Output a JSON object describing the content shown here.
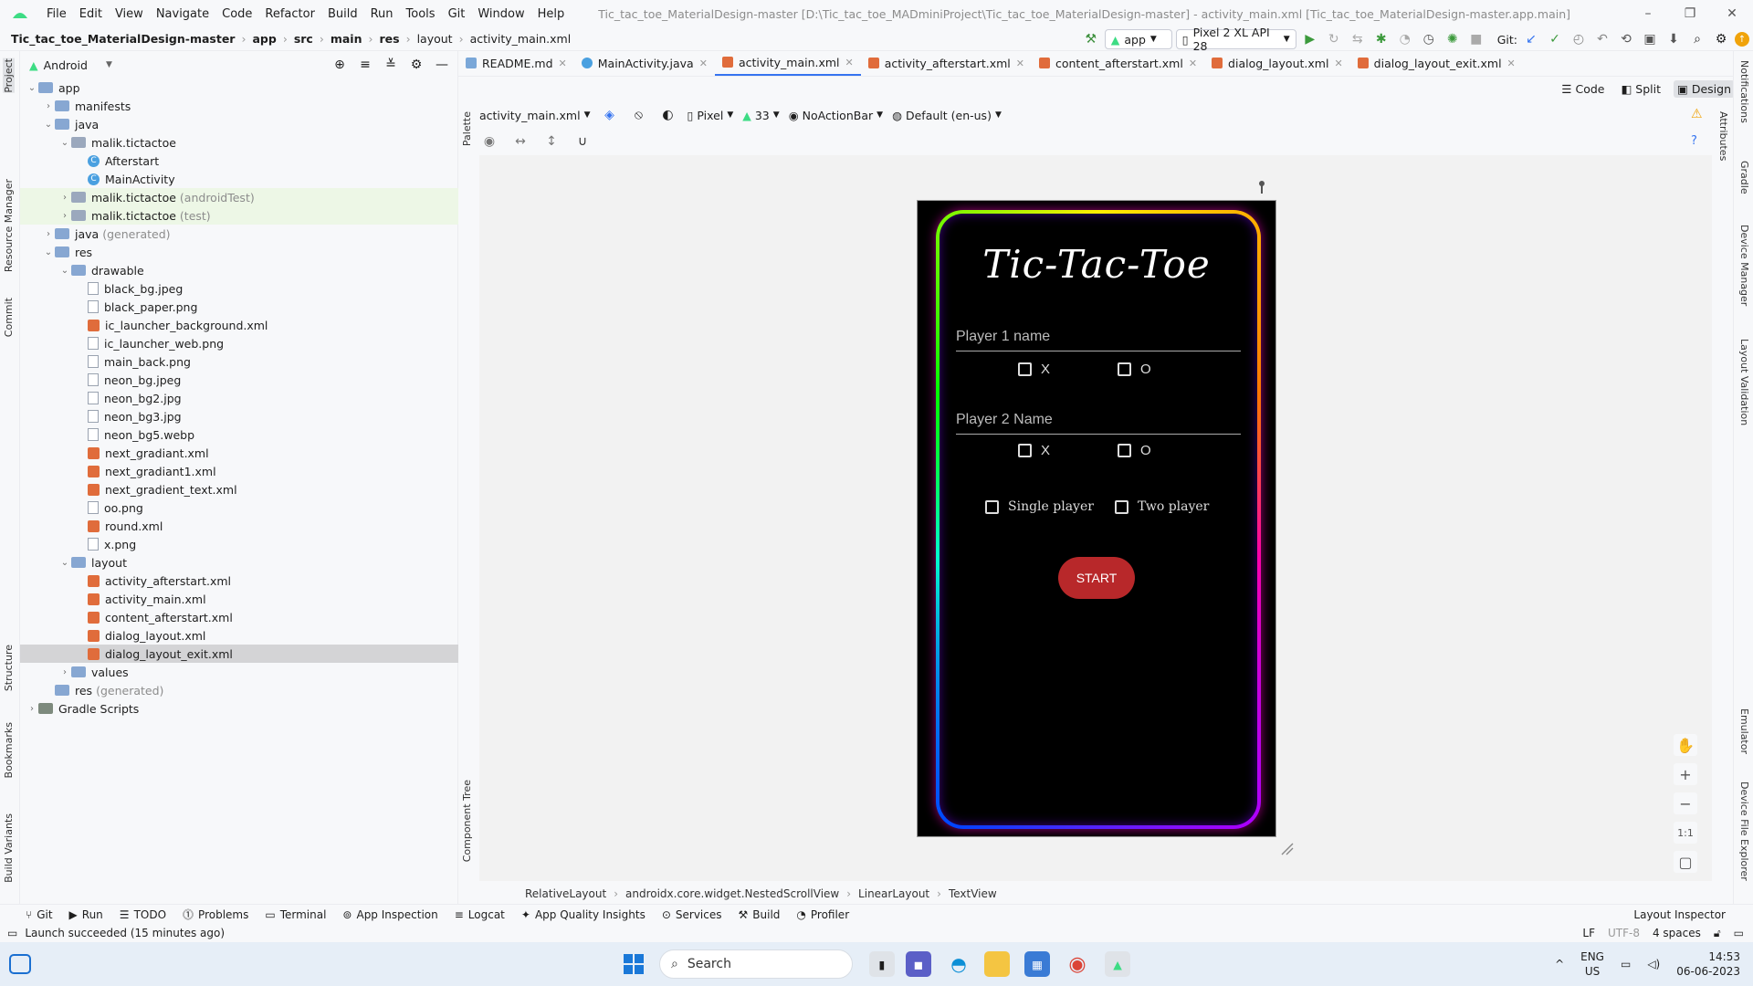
{
  "menubar": {
    "items": [
      "File",
      "Edit",
      "View",
      "Navigate",
      "Code",
      "Refactor",
      "Build",
      "Run",
      "Tools",
      "Git",
      "Window",
      "Help"
    ],
    "window_title": "Tic_tac_toe_MaterialDesign-master [D:\\Tic_tac_toe_MADminiProject\\Tic_tac_toe_MaterialDesign-master] - activity_main.xml [Tic_tac_toe_MaterialDesign-master.app.main]"
  },
  "navbar": {
    "breadcrumbs": [
      "Tic_tac_toe_MaterialDesign-master",
      "app",
      "src",
      "main",
      "res",
      "layout",
      "activity_main.xml"
    ],
    "run_config": "app",
    "device": "Pixel 2 XL API 28",
    "git_label": "Git:"
  },
  "project_panel": {
    "view_mode": "Android",
    "tree": [
      {
        "label": "app",
        "note": "",
        "icon": "folder",
        "expanded": true
      },
      {
        "label": "manifests",
        "note": "",
        "icon": "folder",
        "expanded": false
      },
      {
        "label": "java",
        "note": "",
        "icon": "folder",
        "expanded": true
      },
      {
        "label": "malik.tictactoe",
        "note": "",
        "icon": "package",
        "expanded": true
      },
      {
        "label": "Afterstart",
        "note": "",
        "icon": "class"
      },
      {
        "label": "MainActivity",
        "note": "",
        "icon": "class"
      },
      {
        "label": "malik.tictactoe",
        "note": "(androidTest)",
        "icon": "package",
        "expanded": false
      },
      {
        "label": "malik.tictactoe",
        "note": "(test)",
        "icon": "package",
        "expanded": false
      },
      {
        "label": "java",
        "note": "(generated)",
        "icon": "folder",
        "expanded": false
      },
      {
        "label": "res",
        "note": "",
        "icon": "folder",
        "expanded": true
      },
      {
        "label": "drawable",
        "note": "",
        "icon": "folder",
        "expanded": true
      },
      {
        "label": "black_bg.jpeg",
        "note": "",
        "icon": "image"
      },
      {
        "label": "black_paper.png",
        "note": "",
        "icon": "image"
      },
      {
        "label": "ic_launcher_background.xml",
        "note": "",
        "icon": "xml"
      },
      {
        "label": "ic_launcher_web.png",
        "note": "",
        "icon": "image"
      },
      {
        "label": "main_back.png",
        "note": "",
        "icon": "image"
      },
      {
        "label": "neon_bg.jpeg",
        "note": "",
        "icon": "image"
      },
      {
        "label": "neon_bg2.jpg",
        "note": "",
        "icon": "image"
      },
      {
        "label": "neon_bg3.jpg",
        "note": "",
        "icon": "image"
      },
      {
        "label": "neon_bg5.webp",
        "note": "",
        "icon": "image"
      },
      {
        "label": "next_gradiant.xml",
        "note": "",
        "icon": "xml"
      },
      {
        "label": "next_gradiant1.xml",
        "note": "",
        "icon": "xml"
      },
      {
        "label": "next_gradient_text.xml",
        "note": "",
        "icon": "xml"
      },
      {
        "label": "oo.png",
        "note": "",
        "icon": "image"
      },
      {
        "label": "round.xml",
        "note": "",
        "icon": "xml"
      },
      {
        "label": "x.png",
        "note": "",
        "icon": "image"
      },
      {
        "label": "layout",
        "note": "",
        "icon": "folder",
        "expanded": true
      },
      {
        "label": "activity_afterstart.xml",
        "note": "",
        "icon": "xml"
      },
      {
        "label": "activity_main.xml",
        "note": "",
        "icon": "xml"
      },
      {
        "label": "content_afterstart.xml",
        "note": "",
        "icon": "xml"
      },
      {
        "label": "dialog_layout.xml",
        "note": "",
        "icon": "xml"
      },
      {
        "label": "dialog_layout_exit.xml",
        "note": "",
        "icon": "xml"
      },
      {
        "label": "values",
        "note": "",
        "icon": "folder",
        "expanded": false
      },
      {
        "label": "res",
        "note": "(generated)",
        "icon": "folder"
      },
      {
        "label": "Gradle Scripts",
        "note": "",
        "icon": "gradle",
        "expanded": false
      }
    ]
  },
  "left_strip": [
    "Project",
    "Resource Manager",
    "Commit",
    "Structure",
    "Bookmarks",
    "Build Variants"
  ],
  "right_strip": [
    "Notifications",
    "Gradle",
    "Device Manager",
    "Layout Validation",
    "Emulator",
    "Device File Explorer"
  ],
  "editor_tabs": [
    "README.md",
    "MainActivity.java",
    "activity_main.xml",
    "activity_afterstart.xml",
    "content_afterstart.xml",
    "dialog_layout.xml",
    "dialog_layout_exit.xml"
  ],
  "editor_modes": [
    "Code",
    "Split",
    "Design"
  ],
  "design_toolbar": {
    "file": "activity_main.xml",
    "device": "Pixel",
    "api": "33",
    "theme": "NoActionBar",
    "locale": "Default (en-us)"
  },
  "side_labels": {
    "palette": "Palette",
    "component_tree": "Component Tree",
    "attributes": "Attributes"
  },
  "device_preview": {
    "title": "Tic-Tac-Toe",
    "player1_hint": "Player 1 name",
    "player2_hint": "Player 2 Name",
    "x_label": "X",
    "o_label": "O",
    "single_player": "Single player",
    "two_player": "Two player",
    "start": "START"
  },
  "zoom": {
    "one_to_one": "1:1"
  },
  "element_breadcrumb": [
    "RelativeLayout",
    "androidx.core.widget.NestedScrollView",
    "LinearLayout",
    "TextView"
  ],
  "tool_windows": [
    "Git",
    "Run",
    "TODO",
    "Problems",
    "Terminal",
    "App Inspection",
    "Logcat",
    "App Quality Insights",
    "Services",
    "Build",
    "Profiler"
  ],
  "layout_inspector": "Layout Inspector",
  "status": {
    "message": "Launch succeeded (15 minutes ago)",
    "line_sep": "LF",
    "encoding": "UTF-8",
    "indent": "4 spaces"
  },
  "taskbar": {
    "search": "Search",
    "lang": "ENG",
    "region": "US",
    "time": "14:53",
    "date": "06-06-2023"
  }
}
